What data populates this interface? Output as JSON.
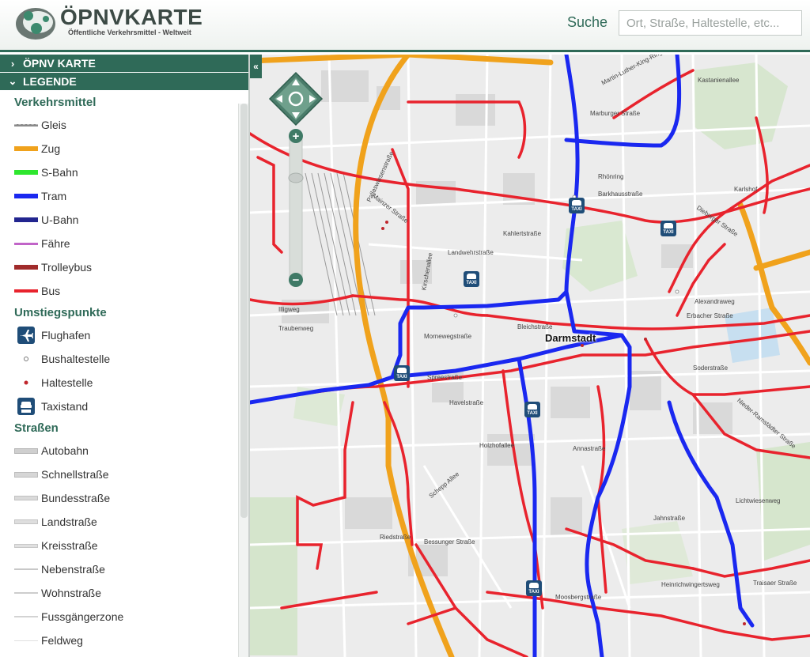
{
  "header": {
    "logo_title": "ÖPNVKARTE",
    "logo_subtitle": "Öffentliche Verkehrsmittel - Weltweit",
    "search_label": "Suche",
    "search_placeholder": "Ort, Straße, Haltestelle, etc..."
  },
  "sidebar": {
    "section_oepnv": "ÖPNV KARTE",
    "section_legende": "LEGENDE",
    "collapse_glyph": "«",
    "groups": [
      {
        "title": "Verkehrsmittel",
        "items": [
          {
            "label": "Gleis",
            "icon": "gleis-line",
            "color": "#8a8a8a"
          },
          {
            "label": "Zug",
            "icon": "zug-line",
            "color": "#f0a21c"
          },
          {
            "label": "S-Bahn",
            "icon": "sbahn-line",
            "color": "#2ee62e"
          },
          {
            "label": "Tram",
            "icon": "tram-line",
            "color": "#1a28f0"
          },
          {
            "label": "U-Bahn",
            "icon": "ubahn-line",
            "color": "#22258f"
          },
          {
            "label": "Fähre",
            "icon": "faehre-line",
            "color": "#c164c8"
          },
          {
            "label": "Trolleybus",
            "icon": "trolleybus-line",
            "color": "#a02b2b"
          },
          {
            "label": "Bus",
            "icon": "bus-line",
            "color": "#e8232d"
          }
        ]
      },
      {
        "title": "Umstiegspunkte",
        "items": [
          {
            "label": "Flughafen",
            "icon": "airport-icon"
          },
          {
            "label": "Bushaltestelle",
            "icon": "bus-stop-icon"
          },
          {
            "label": "Haltestelle",
            "icon": "stop-icon"
          },
          {
            "label": "Taxistand",
            "icon": "taxi-icon"
          }
        ]
      },
      {
        "title": "Straßen",
        "items": [
          {
            "label": "Autobahn",
            "icon": "road-autobahn"
          },
          {
            "label": "Schnellstraße",
            "icon": "road-schnell"
          },
          {
            "label": "Bundesstraße",
            "icon": "road-bundes"
          },
          {
            "label": "Landstraße",
            "icon": "road-land"
          },
          {
            "label": "Kreisstraße",
            "icon": "road-kreis"
          },
          {
            "label": "Nebenstraße",
            "icon": "road-neben"
          },
          {
            "label": "Wohnstraße",
            "icon": "road-wohn"
          },
          {
            "label": "Fussgängerzone",
            "icon": "road-fuss"
          },
          {
            "label": "Feldweg",
            "icon": "road-feld"
          }
        ]
      }
    ]
  },
  "map": {
    "city_label": "Darmstadt",
    "zoom_in": "+",
    "zoom_out": "−",
    "street_labels": [
      "Martin-Luther-King-Ring",
      "Marburger Straße",
      "Kastanienallee",
      "Rhönring",
      "Barkhausstraße",
      "Kahlertstraße",
      "Landwehrstraße",
      "Mainzer Straße",
      "Pallaswiesenstraße",
      "Kirschenallee",
      "Bleichstraße",
      "Mornewegstraße",
      "Spreestraße",
      "Havelstraße",
      "Holzhofallee",
      "Schepp Allee",
      "Bessunger Straße",
      "Annastraße",
      "Moosbergstraße",
      "Heinrichwingertsweg",
      "Jahnstraße",
      "Soderstraße",
      "Alexandraweg",
      "Erbacher Straße",
      "Lichtwiesenweg",
      "Traisaer Straße",
      "Traubenweg",
      "Illigweg",
      "Riedstraße",
      "Karlshof",
      "Dieburger Straße",
      "Nieder-Ramstädter Straße"
    ]
  }
}
